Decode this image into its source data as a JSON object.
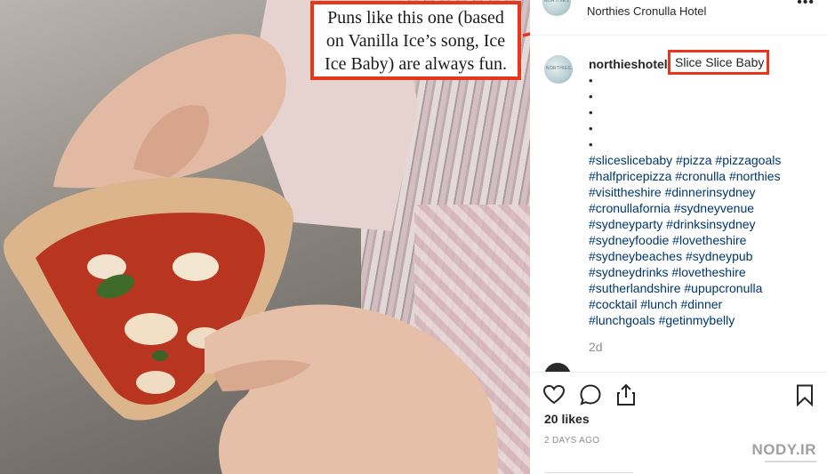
{
  "callout": {
    "text": "Puns like this one (based on Vanilla Ice’s song, Ice Ice Baby) are always fun."
  },
  "post": {
    "header_name": "Northies Cronulla Hotel",
    "avatar_text": "NORTHIES",
    "username": "northieshotel",
    "caption_highlight": "Slice Slice Baby",
    "bullets": [
      "•",
      "•",
      "•",
      "•",
      "•"
    ],
    "hashtag_lines": [
      "#sliceslicebaby #pizza #pizzagoals",
      "#halfpricepizza #cronulla #northies",
      "#visittheshire #dinnerinsydney",
      "#cronullafornia #sydneyvenue",
      "#sydneyparty #drinksinsydney",
      "#sydneyfoodie #lovetheshire",
      "#sydneybeaches #sydneypub",
      "#sydneydrinks #lovetheshire",
      "#sutherlandshire #upupcronulla",
      "#cocktail #lunch #dinner",
      "#lunchgoals #getinmybelly"
    ],
    "time_ago": "2d",
    "likes": "20 likes",
    "posted": "2 DAYS AGO"
  },
  "icons": {
    "more": "•••",
    "like": "heart-icon",
    "comment": "comment-icon",
    "share": "share-icon",
    "save": "bookmark-icon"
  },
  "watermark": {
    "main": "NODY.IR"
  },
  "colors": {
    "annotation": "#e8361b",
    "hashtag": "#00376b",
    "muted": "#8e8e8e"
  }
}
